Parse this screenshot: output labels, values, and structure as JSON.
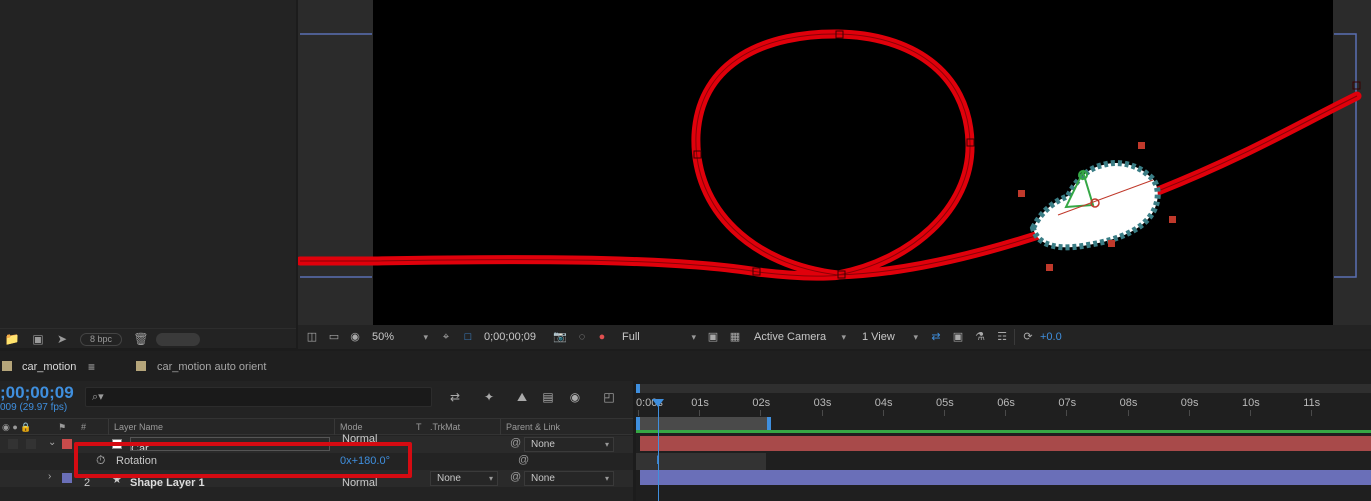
{
  "project_panel": {
    "bpc_label": "8 bpc"
  },
  "viewer": {
    "background": "#000000",
    "path_color": "#e0000b",
    "car_body_color": "#ffffff",
    "car_outline_color": "#3a7d85"
  },
  "viewer_toolbar": {
    "zoom": "50%",
    "timecode": "0;00;00;09",
    "resolution": "Full",
    "camera": "Active Camera",
    "views": "1 View",
    "exposure": "+0.0"
  },
  "tabs": [
    {
      "label": "car_motion",
      "swatch": "#b5a57a",
      "active": true
    },
    {
      "label": "car_motion auto orient",
      "swatch": "#b5a57a",
      "active": false
    }
  ],
  "timeline": {
    "timecode": ";00;00;09",
    "fps": "009 (29.97 fps)",
    "search_glyph": "⌕▾",
    "columns": {
      "hash": "#",
      "layer_name": "Layer Name",
      "mode": "Mode",
      "t": "T",
      "trkmat": ".TrkMat",
      "parent_link": "Parent & Link"
    },
    "layers": [
      {
        "name": "Car",
        "mode": "Normal",
        "parent": "None",
        "label_color": "#c94b4b"
      },
      {
        "name": "Rotation",
        "value": "0x+180.0°"
      },
      {
        "number": "2",
        "name": "Shape Layer 1",
        "mode": "Normal",
        "trkmat": "None",
        "parent": "None",
        "label_color": "#6a6fb8"
      }
    ],
    "ruler": [
      "0:00s",
      "01s",
      "02s",
      "03s",
      "04s",
      "05s",
      "06s",
      "07s",
      "08s",
      "09s",
      "10s",
      "11s"
    ],
    "current_time_marker": "I"
  }
}
